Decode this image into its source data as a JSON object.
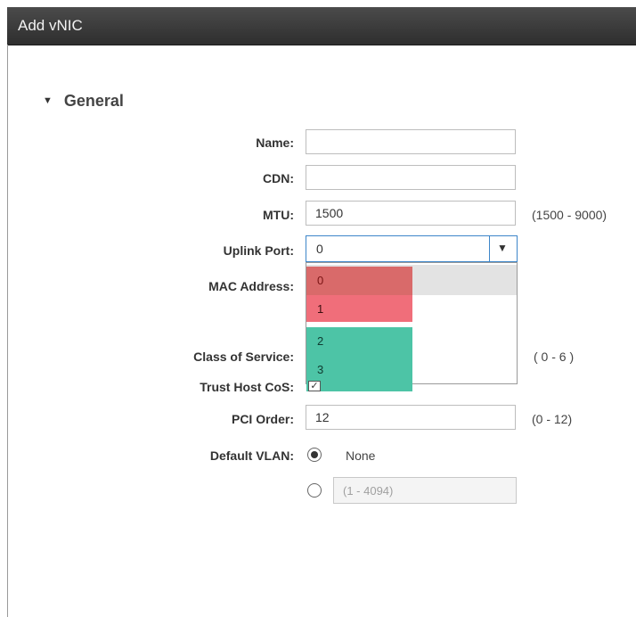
{
  "window": {
    "title": "Add vNIC"
  },
  "section": {
    "caret_icon": "caret-down-icon",
    "label": "General"
  },
  "fields": {
    "name": {
      "label": "Name:",
      "value": ""
    },
    "cdn": {
      "label": "CDN:",
      "value": ""
    },
    "mtu": {
      "label": "MTU:",
      "value": "1500",
      "range": "(1500 - 9000)"
    },
    "uplink_port": {
      "label": "Uplink Port:",
      "selected": "0",
      "arrow_icon": "dropdown-arrow-icon",
      "options": [
        "0",
        "1",
        "2",
        "3"
      ],
      "option_colors": [
        "#d96a6a",
        "#f06e7a",
        "#4dc4a6",
        "#4dc4a6"
      ]
    },
    "mac_address": {
      "label": "MAC Address:"
    },
    "class_of_service": {
      "label": "Class of Service:",
      "range": "( 0 - 6 )"
    },
    "trust_host_cos": {
      "label": "Trust Host CoS:",
      "checked": true
    },
    "pci_order": {
      "label": "PCI Order:",
      "value": "12",
      "range": "(0 - 12)"
    },
    "default_vlan": {
      "label": "Default VLAN:",
      "none_option": "None",
      "none_selected": true,
      "custom_placeholder": "(1 - 4094)"
    }
  }
}
